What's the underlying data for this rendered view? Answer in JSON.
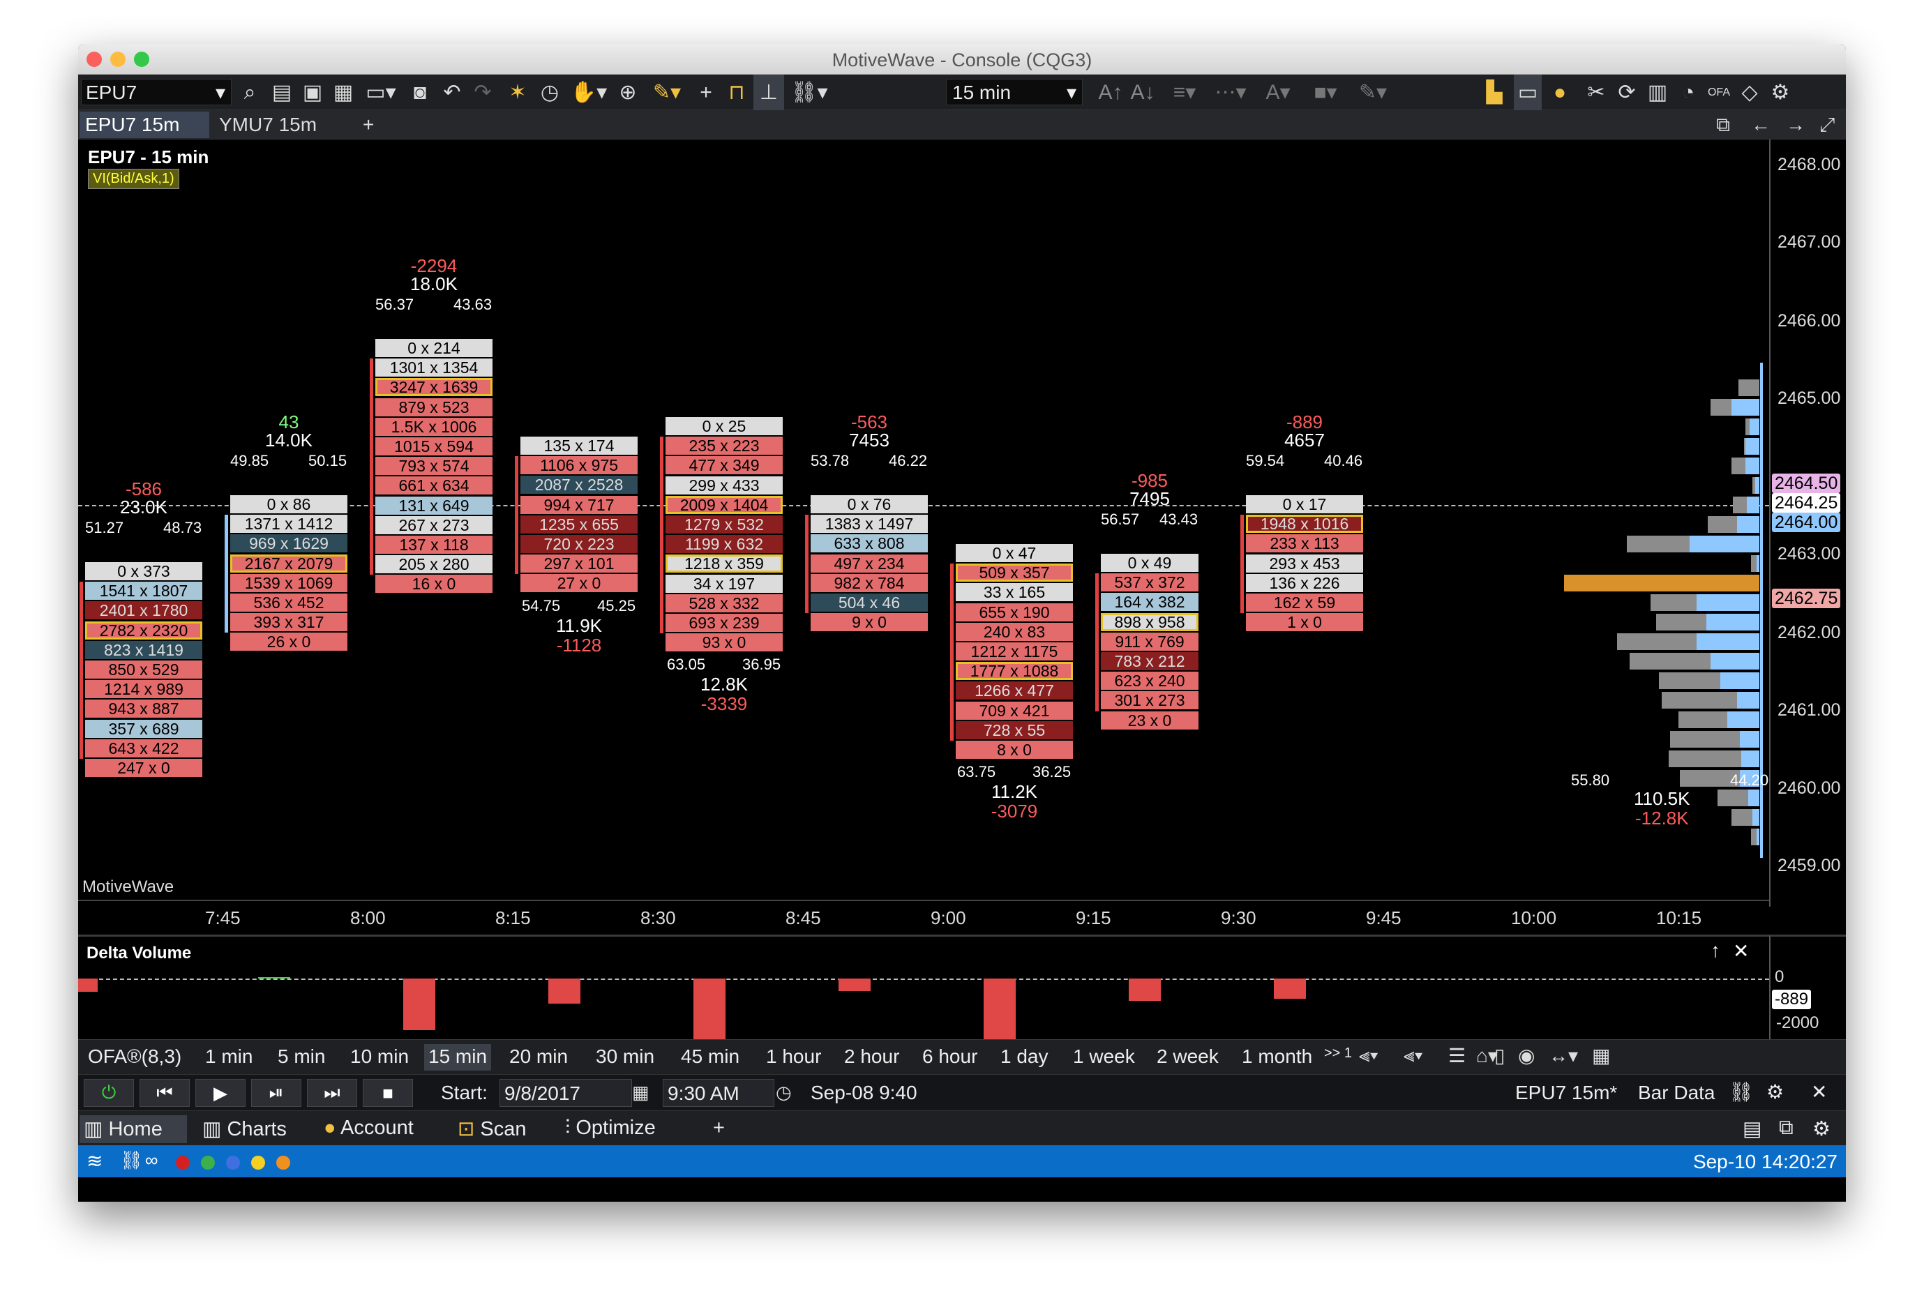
{
  "window": {
    "title": "MotiveWave - Console (CQG3)"
  },
  "toolbar": {
    "symbol": "EPU7",
    "timeframe": "15 min"
  },
  "tabs": [
    {
      "label": "EPU7 15m",
      "active": true
    },
    {
      "label": "YMU7 15m",
      "active": false
    }
  ],
  "chart": {
    "title": "EPU7 - 15 min",
    "study_label": "VI(Bid/Ask,1)",
    "watermark": "MotiveWave",
    "price_labels": [
      "2468.00",
      "2467.00",
      "2466.00",
      "2465.00",
      "2463.00",
      "2462.00",
      "2461.00",
      "2460.00",
      "2459.00"
    ],
    "price_tags": [
      {
        "value": "2464.50",
        "color": "#e8b4e8"
      },
      {
        "value": "2464.25",
        "color": "#ffffff"
      },
      {
        "value": "2464.00",
        "color": "#8fc7ff"
      },
      {
        "value": "2462.75",
        "color": "#f2a7a7"
      }
    ],
    "time_labels": [
      "7:45",
      "8:00",
      "8:15",
      "8:30",
      "8:45",
      "9:00",
      "9:15",
      "9:30",
      "9:45",
      "10:00",
      "10:15"
    ]
  },
  "bars": [
    {
      "delta": "-586",
      "volume": "23.0K",
      "left_pct": "51.27",
      "right_pct": "48.73",
      "bottom_left": "",
      "bottom_right": "",
      "cells": [
        "0 x 373",
        "1541 x 1807",
        "2401 x 1780",
        "2782 x 2320",
        "823 x 1419",
        "850 x 529",
        "1214 x 989",
        "943 x 887",
        "357 x 689",
        "643 x 422",
        "247 x 0"
      ]
    },
    {
      "delta": "43",
      "volume": "14.0K",
      "left_pct": "49.85",
      "right_pct": "50.15",
      "bottom_left": "",
      "bottom_right": "",
      "cells": [
        "0 x 86",
        "1371 x 1412",
        "969 x 1629",
        "2167 x 2079",
        "1539 x 1069",
        "536 x 452",
        "393 x 317",
        "26 x 0"
      ]
    },
    {
      "delta": "-2294",
      "volume": "18.0K",
      "left_pct": "56.37",
      "right_pct": "43.63",
      "bottom_left": "",
      "bottom_right": "",
      "cells": [
        "0 x 214",
        "1301 x 1354",
        "3247 x 1639",
        "879 x 523",
        "1.5K x 1006",
        "1015 x 594",
        "793 x 574",
        "661 x 634",
        "131 x 649",
        "267 x 273",
        "137 x 118",
        "205 x 280",
        "16 x 0"
      ]
    },
    {
      "delta": "-1128",
      "volume": "11.9K",
      "left_pct": "",
      "right_pct": "",
      "bottom_left": "54.75",
      "bottom_right": "45.25",
      "cells": [
        "135 x 174",
        "1106 x 975",
        "2087 x 2528",
        "994 x 717",
        "1235 x 655",
        "720 x 223",
        "297 x 101",
        "27 x 0"
      ]
    },
    {
      "delta": "-3339",
      "volume": "12.8K",
      "left_pct": "",
      "right_pct": "",
      "bottom_left": "63.05",
      "bottom_right": "36.95",
      "cells": [
        "0 x 25",
        "235 x 223",
        "477 x 349",
        "299 x 433",
        "2009 x 1404",
        "1279 x 532",
        "1199 x 632",
        "1218 x 359",
        "34 x 197",
        "528 x 332",
        "693 x 239",
        "93 x 0"
      ]
    },
    {
      "delta": "-563",
      "volume": "7453",
      "left_pct": "53.78",
      "right_pct": "46.22",
      "bottom_left": "",
      "bottom_right": "",
      "cells": [
        "0 x 76",
        "1383 x 1497",
        "633 x 808",
        "497 x 234",
        "982 x 784",
        "504 x 46",
        "9 x 0"
      ]
    },
    {
      "delta": "-3079",
      "volume": "11.2K",
      "left_pct": "",
      "right_pct": "",
      "bottom_left": "63.75",
      "bottom_right": "36.25",
      "cells": [
        "0 x 47",
        "509 x 357",
        "33 x 165",
        "655 x 190",
        "240 x 83",
        "1212 x 1175",
        "1777 x 1088",
        "1266 x 477",
        "709 x 421",
        "728 x 55",
        "8 x 0"
      ]
    },
    {
      "delta": "-985",
      "volume": "7495",
      "left_pct": "56.57",
      "right_pct": "43.43",
      "bottom_left": "",
      "bottom_right": "",
      "cells": [
        "0 x 49",
        "537 x 372",
        "164 x 382",
        "898 x 958",
        "911 x 769",
        "783 x 212",
        "623 x 240",
        "301 x 273",
        "23 x 0"
      ]
    },
    {
      "delta": "-889",
      "volume": "4657",
      "left_pct": "59.54",
      "right_pct": "40.46",
      "bottom_left": "",
      "bottom_right": "",
      "cells": [
        "0 x 17",
        "1948 x 1016",
        "233 x 113",
        "293 x 453",
        "136 x 226",
        "162 x 59",
        "1 x 0"
      ]
    }
  ],
  "profile": {
    "left_pct": "55.80",
    "right_pct": "44.20",
    "volume": "110.5K",
    "delta": "-12.8K"
  },
  "delta_panel": {
    "title": "Delta Volume",
    "axis_labels": [
      "0",
      "-889",
      "-2000"
    ],
    "values": [
      -586,
      43,
      -2294,
      -1128,
      -3339,
      -563,
      -3079,
      -985,
      -889
    ]
  },
  "timeframes": [
    "OFA®(8,3)",
    "1 min",
    "5 min",
    "10 min",
    "15 min",
    "20 min",
    "30 min",
    "45 min",
    "1 hour",
    "2 hour",
    "6 hour",
    "1 day",
    "1 week",
    "2 week",
    "1 month"
  ],
  "timeframe_more": ">> 1",
  "playback": {
    "start_label": "Start:",
    "start_date": "9/8/2017",
    "start_time": "9:30 AM",
    "current": "Sep-08 9:40",
    "chart_ref": "EPU7 15m*",
    "data_label": "Bar Data"
  },
  "nav": {
    "home": "Home",
    "charts": "Charts",
    "account": "Account",
    "scan": "Scan",
    "optimize": "Optimize"
  },
  "status": {
    "datetime": "Sep-10 14:20:27"
  }
}
